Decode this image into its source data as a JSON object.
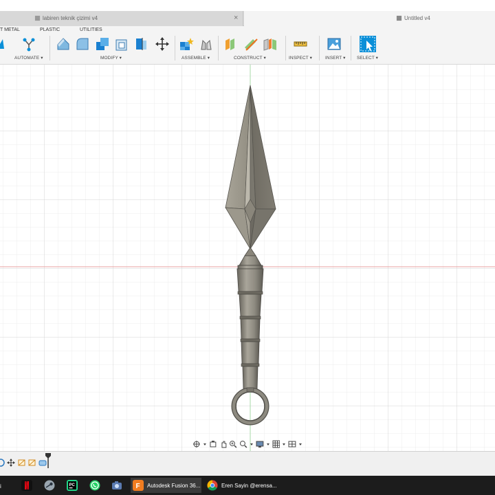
{
  "tabs": {
    "inactive_label": "labiren teknik çizimi v4",
    "active_label": "Untitled v4",
    "close_glyph": "×"
  },
  "ribbon": {
    "tabs": [
      "T METAL",
      "PLASTIC",
      "UTILITIES"
    ],
    "groups": {
      "automate": "AUTOMATE ▾",
      "modify": "MODIFY ▾",
      "assemble": "ASSEMBLE ▾",
      "construct": "CONSTRUCT ▾",
      "inspect": "INSPECT ▾",
      "insert": "INSERT ▾",
      "select": "SELECT ▾"
    }
  },
  "taskbar": {
    "left_fragment": "i",
    "fusion_label": "Autodesk Fusion 36...",
    "chrome_label": "Eren Sayin @erensa..."
  },
  "colors": {
    "accent_blue": "#0a8fd8",
    "model_gray": "#8d8a80",
    "axis_red": "#e8a0a0",
    "axis_green": "#a8d8a8"
  }
}
